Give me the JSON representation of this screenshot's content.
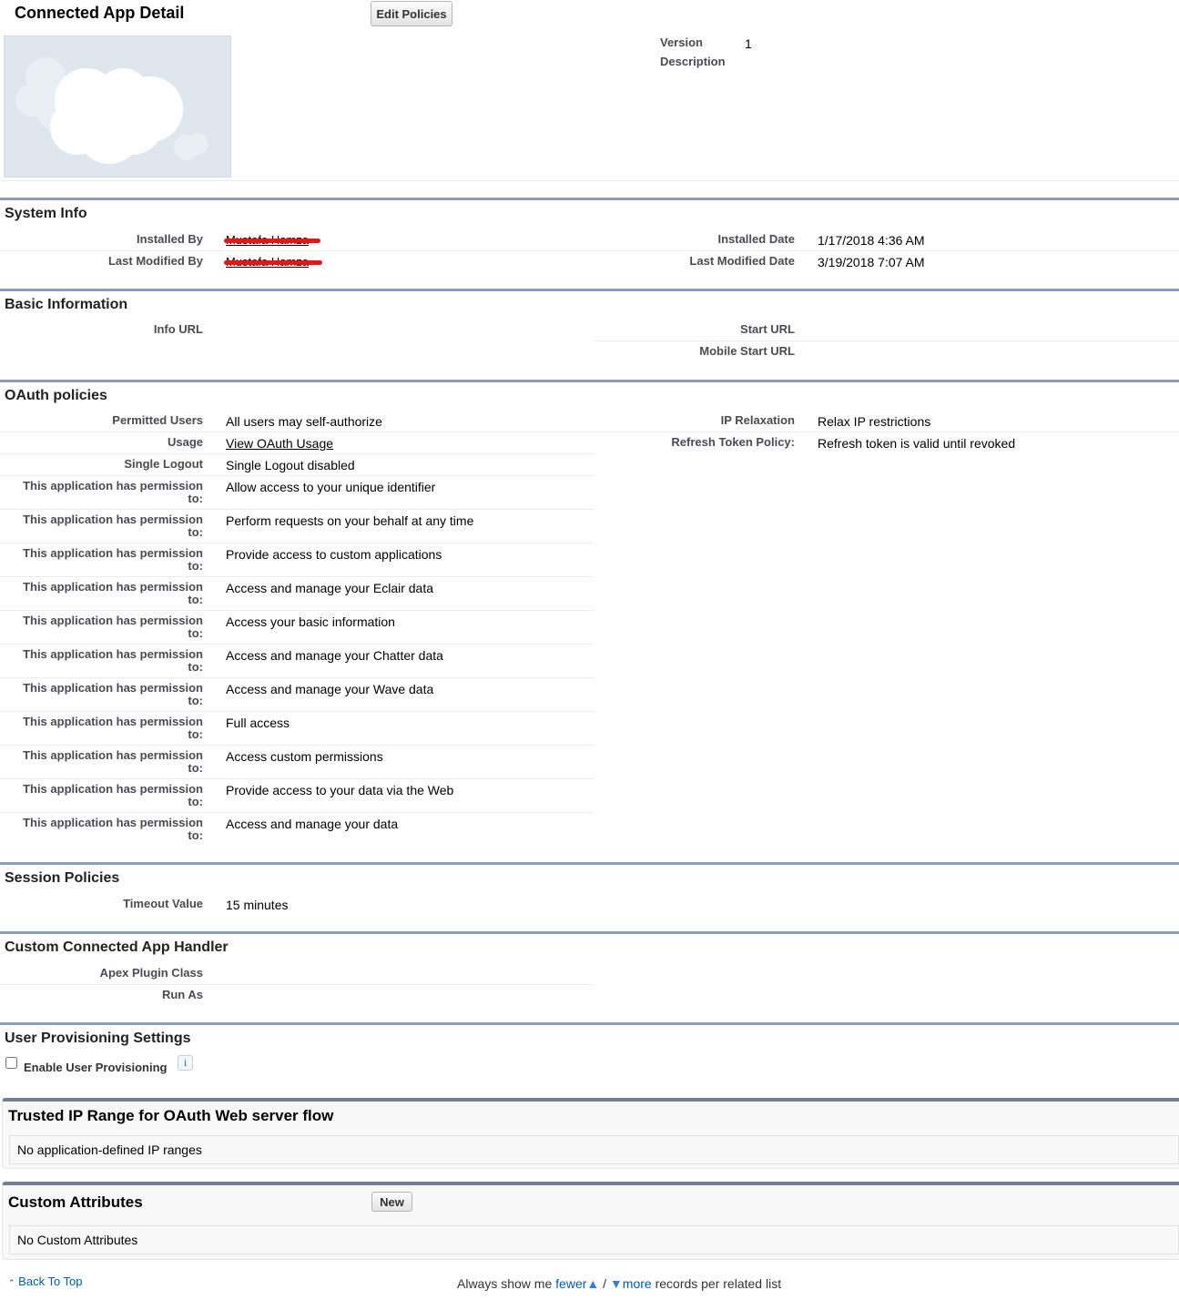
{
  "header": {
    "title": "Connected App Detail",
    "edit_policies": "Edit Policies",
    "version_label": "Version",
    "version": "1",
    "description_label": "Description"
  },
  "system_info": {
    "title": "System Info",
    "installed_by_label": "Installed By",
    "installed_by": "Mustafa Hamza",
    "last_modified_by_label": "Last Modified By",
    "last_modified_by": "Mustafa Hamza",
    "installed_date_label": "Installed Date",
    "installed_date": "1/17/2018 4:36 AM",
    "last_modified_date_label": "Last Modified Date",
    "last_modified_date": "3/19/2018 7:07 AM"
  },
  "basic": {
    "title": "Basic Information",
    "info_url_label": "Info URL",
    "start_url_label": "Start URL",
    "mobile_start_url_label": "Mobile Start URL"
  },
  "oauth": {
    "title": "OAuth policies",
    "permitted_users_label": "Permitted Users",
    "permitted_users": "All users may self-authorize",
    "usage_label": "Usage",
    "usage": "View OAuth Usage",
    "single_logout_label": "Single Logout",
    "single_logout": "Single Logout disabled",
    "ip_relaxation_label": "IP Relaxation",
    "ip_relaxation": "Relax IP restrictions",
    "refresh_label": "Refresh Token Policy:",
    "refresh": "Refresh token is valid until revoked",
    "permission_label_1": "This application has permission",
    "permission_label_2": "to:",
    "permissions": [
      "Allow access to your unique identifier",
      "Perform requests on your behalf at any time",
      "Provide access to custom applications",
      "Access and manage your Eclair data",
      "Access your basic information",
      "Access and manage your Chatter data",
      "Access and manage your Wave data",
      "Full access",
      "Access custom permissions",
      "Provide access to your data via the Web",
      "Access and manage your data"
    ]
  },
  "session": {
    "title": "Session Policies",
    "timeout_label": "Timeout Value",
    "timeout": "15 minutes"
  },
  "handler": {
    "title": "Custom Connected App Handler",
    "apex_label": "Apex Plugin Class",
    "run_as_label": "Run As"
  },
  "provisioning": {
    "title": "User Provisioning Settings",
    "enable_label": "Enable User Provisioning",
    "info": "i"
  },
  "trusted_ip": {
    "title": "Trusted IP Range for OAuth Web server flow",
    "empty": "No application-defined IP ranges"
  },
  "custom_attributes": {
    "title": "Custom Attributes",
    "new": "New",
    "empty": "No Custom Attributes"
  },
  "footer": {
    "back_to_top": "Back To Top",
    "always": "Always show me",
    "fewer": "fewer",
    "sep": "/",
    "more": "more",
    "suffix": "records per related list"
  }
}
